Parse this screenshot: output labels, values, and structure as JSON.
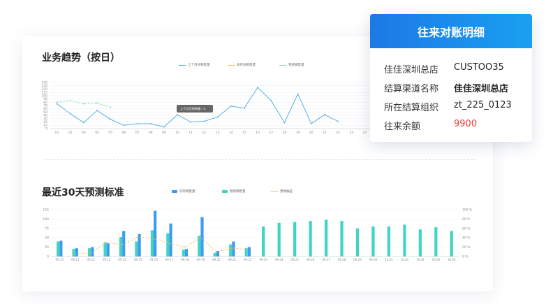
{
  "section1": {
    "title": "业务趋势（按日）",
    "legend": [
      {
        "label": "上个月日销售量",
        "color": "#4aa8e8",
        "style": "line"
      },
      {
        "label": "本月日销售量",
        "color": "#f6b34a",
        "style": "dash"
      },
      {
        "label": "预测销售量",
        "color": "#6fd6c6",
        "style": "dash"
      }
    ],
    "tooltip": "上个月日销售量：5"
  },
  "section2": {
    "title": "最近30天预测标准",
    "legend": [
      {
        "label": "实际销售量",
        "color": "#3d9cf0",
        "style": "box"
      },
      {
        "label": "预测销售量",
        "color": "#3fd4c4",
        "style": "box"
      },
      {
        "label": "预测偏差",
        "color": "#f6b34a",
        "style": "dash"
      }
    ]
  },
  "chart_data": [
    {
      "type": "line",
      "x": [
        "01",
        "02",
        "03",
        "04",
        "05",
        "06",
        "07",
        "08",
        "09",
        "10",
        "11",
        "12",
        "13",
        "14",
        "15",
        "16",
        "17",
        "18",
        "19",
        "20",
        "21",
        "22",
        "23",
        "24"
      ],
      "ylim": [
        0,
        140
      ],
      "yticks": [
        0,
        10,
        20,
        30,
        40,
        50,
        60,
        70,
        80,
        90,
        100,
        110,
        120,
        130,
        140
      ],
      "grid": true,
      "series": [
        {
          "name": "上个月日销售量",
          "color": "#4aa8e8",
          "values": [
            75,
            45,
            18,
            55,
            28,
            10,
            15,
            15,
            5,
            42,
            20,
            22,
            35,
            68,
            62,
            125,
            85,
            18,
            105,
            15,
            42,
            22,
            null,
            null
          ]
        },
        {
          "name": "本月日销售量",
          "color": "#f6b34a",
          "values": [
            null,
            null,
            null,
            null,
            null,
            null,
            null,
            null,
            null,
            null,
            null,
            null,
            null,
            null,
            null,
            null,
            null,
            null,
            null,
            null,
            null,
            null,
            null,
            null
          ]
        },
        {
          "name": "预测销售量",
          "color": "#6fd6c6",
          "values": [
            80,
            85,
            75,
            78,
            65,
            null,
            null,
            null,
            null,
            null,
            null,
            null,
            null,
            null,
            null,
            null,
            null,
            null,
            null,
            null,
            null,
            null,
            null,
            null
          ]
        }
      ]
    },
    {
      "type": "bar",
      "categories": [
        "09.10",
        "09.11",
        "09.12",
        "09.13",
        "09.14",
        "09.15",
        "09.16",
        "09.17",
        "09.18",
        "09.19",
        "09.20",
        "09.21",
        "09.22",
        "09.23",
        "09.24",
        "09.25",
        "09.26",
        "09.27",
        "09.28",
        "09.29",
        "09.30",
        "10.01",
        "10.02",
        "10.03",
        "10.04",
        "10.05"
      ],
      "ylim": [
        0,
        125
      ],
      "yticks": [
        0,
        25,
        50,
        75,
        100,
        125
      ],
      "y2lim": [
        0,
        100
      ],
      "y2ticks": [
        "0 %",
        "20 %",
        "40 %",
        "60 %",
        "80 %",
        "100 %"
      ],
      "grid": true,
      "series": [
        {
          "name": "实际销售量",
          "color": "#3d9cf0",
          "values": [
            42,
            22,
            25,
            35,
            68,
            60,
            122,
            88,
            20,
            105,
            15,
            40,
            25,
            null,
            null,
            null,
            null,
            null,
            null,
            null,
            null,
            null,
            null,
            null,
            null,
            null
          ]
        },
        {
          "name": "预测销售量",
          "color": "#3fd4c4",
          "values": [
            40,
            20,
            22,
            38,
            52,
            40,
            70,
            62,
            18,
            55,
            10,
            32,
            22,
            80,
            90,
            92,
            95,
            98,
            95,
            75,
            80,
            80,
            85,
            72,
            78,
            68
          ]
        },
        {
          "name": "预测偏差",
          "color": "#f6b34a",
          "values": [
            null,
            5,
            8,
            30,
            25,
            42,
            38,
            28,
            20,
            40,
            10,
            18,
            15,
            null,
            null,
            null,
            null,
            null,
            null,
            null,
            null,
            null,
            null,
            null,
            null,
            null
          ]
        }
      ]
    }
  ],
  "popup": {
    "title": "往来对账明细",
    "rows": [
      {
        "label": "佳佳深圳总店",
        "value": "CUSTOO35"
      },
      {
        "label": "结算渠道名称",
        "value": "佳佳深圳总店"
      },
      {
        "label": "所在结算组织",
        "value": "zt_225_0123"
      },
      {
        "label": "往来余额",
        "value": "9900"
      }
    ],
    "value_color": "#f03a2f"
  }
}
